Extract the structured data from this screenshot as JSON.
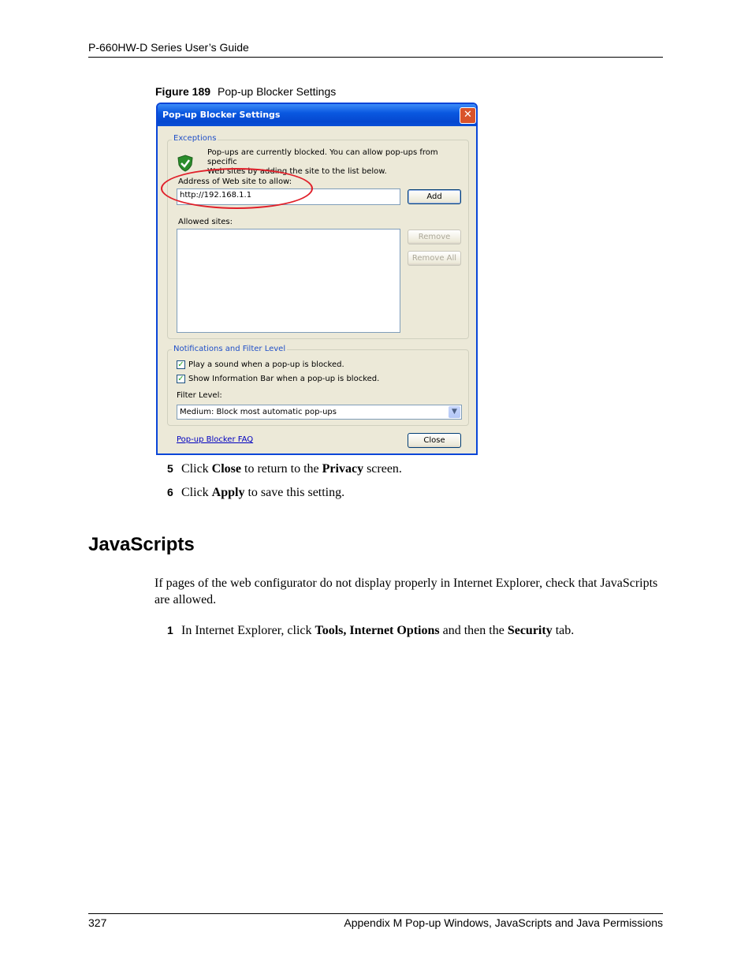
{
  "header": {
    "title": "P-660HW-D Series User’s Guide"
  },
  "figure": {
    "label": "Figure 189",
    "title": "Pop-up Blocker Settings"
  },
  "dialog": {
    "title": "Pop-up Blocker Settings",
    "exceptions": {
      "legend": "Exceptions",
      "info_line1": "Pop-ups are currently blocked.  You can allow pop-ups from specific",
      "info_line2": "Web sites by adding the site to the list below.",
      "address_label": "Address of Web site to allow:",
      "address_value": "http://192.168.1.1",
      "add_button": "Add",
      "allowed_label": "Allowed sites:",
      "remove_button": "Remove",
      "remove_all_button": "Remove All"
    },
    "notifications": {
      "legend": "Notifications and Filter Level",
      "play_sound": {
        "label": "Play a sound when a pop-up is blocked.",
        "checked": true
      },
      "show_info_bar": {
        "label": "Show Information Bar when a pop-up is blocked.",
        "checked": true
      },
      "filter_label": "Filter Level:",
      "filter_value": "Medium: Block most automatic pop-ups"
    },
    "faq_link": "Pop-up Blocker FAQ",
    "close_button": "Close"
  },
  "steps_a": [
    {
      "num": "5",
      "pre": "Click ",
      "bold": "Close",
      "mid": " to return to the ",
      "bold2": "Privacy",
      "post": " screen."
    },
    {
      "num": "6",
      "pre": "Click ",
      "bold": "Apply",
      "post": " to save this setting."
    }
  ],
  "section": {
    "title": "JavaScripts",
    "paragraph": "If pages of the web configurator do not display properly in Internet Explorer, check that JavaScripts are allowed."
  },
  "steps_b": [
    {
      "num": "1",
      "pre": "In Internet Explorer, click ",
      "bold": "Tools",
      "sep": ", ",
      "bold2": "Internet Options",
      "mid": " and then the ",
      "bold3": "Security",
      "post": " tab."
    }
  ],
  "footer": {
    "page_number": "327",
    "chapter": "Appendix M Pop-up Windows, JavaScripts and Java Permissions"
  }
}
